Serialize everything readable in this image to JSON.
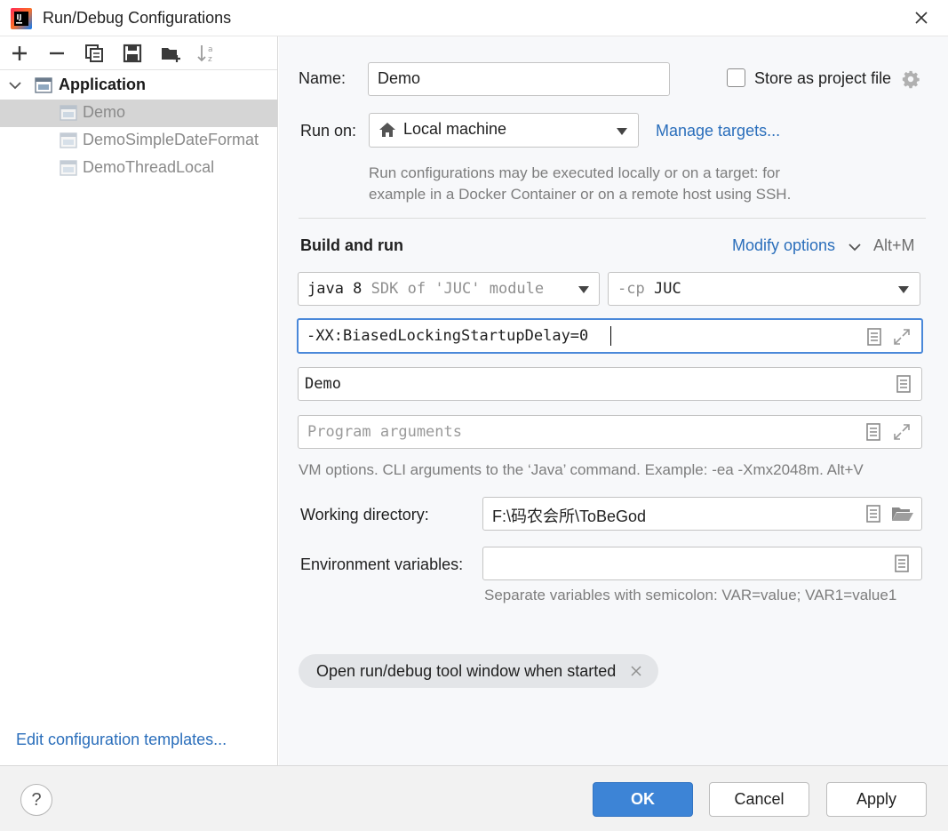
{
  "window": {
    "title": "Run/Debug Configurations"
  },
  "toolbar": {
    "icons": [
      "add-icon",
      "remove-icon",
      "copy-icon",
      "save-icon",
      "new-folder-icon",
      "sort-alpha-icon"
    ]
  },
  "tree": {
    "parent_label": "Application",
    "children": [
      "Demo",
      "DemoSimpleDateFormat",
      "DemoThreadLocal"
    ],
    "selected": "Demo"
  },
  "left_footer": {
    "edit_templates_link": "Edit configuration templates..."
  },
  "form": {
    "name_label": "Name:",
    "name_value": "Demo",
    "store_as_project_label": "Store as project file",
    "run_on_label": "Run on:",
    "run_on_value": "Local machine",
    "manage_targets_link": "Manage targets...",
    "run_on_hint_line1": "Run configurations may be executed locally or on a target: for",
    "run_on_hint_line2": "example in a Docker Container or on a remote host using SSH.",
    "build_and_run_heading": "Build and run",
    "modify_options_link": "Modify options",
    "modify_options_shortcut": "Alt+M",
    "jdk_java": "java 8",
    "jdk_detail": "SDK of 'JUC' module",
    "cp_prefix": "-cp",
    "cp_value": "JUC",
    "vm_options_value": "-XX:BiasedLockingStartupDelay=0",
    "main_class_value": "Demo",
    "program_args_placeholder": "Program arguments",
    "vm_hint": "VM options. CLI arguments to the ‘Java’ command. Example: -ea -Xmx2048m. Alt+V",
    "working_dir_label": "Working directory:",
    "working_dir_value": "F:\\码农会所\\ToBeGod",
    "env_vars_label": "Environment variables:",
    "env_vars_value": "",
    "env_vars_hint": "Separate variables with semicolon: VAR=value; VAR1=value1",
    "chip_label": "Open run/debug tool window when started"
  },
  "buttons": {
    "help": "?",
    "ok": "OK",
    "cancel": "Cancel",
    "apply": "Apply"
  },
  "colors": {
    "accent": "#3d84d6",
    "link": "#2a6ebb",
    "selected_row": "#d5d5d5"
  }
}
